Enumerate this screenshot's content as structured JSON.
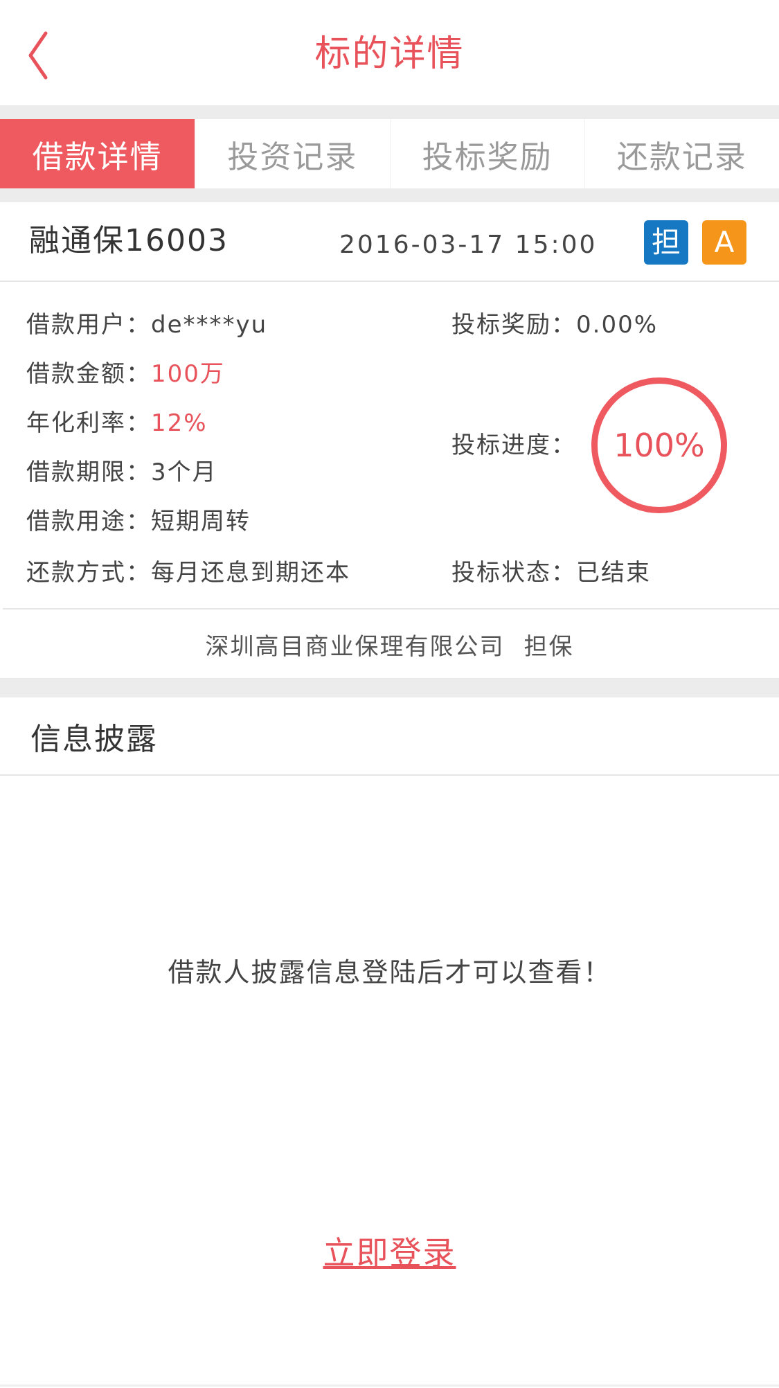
{
  "header": {
    "title": "标的详情",
    "back_icon": "chevron-left-icon"
  },
  "tabs": [
    {
      "label": "借款详情",
      "active": true
    },
    {
      "label": "投资记录",
      "active": false
    },
    {
      "label": "投标奖励",
      "active": false
    },
    {
      "label": "还款记录",
      "active": false
    }
  ],
  "loan": {
    "name": "融通保16003",
    "datetime": "2016-03-17 15:00",
    "badges": {
      "guarantee": "担",
      "grade": "A"
    }
  },
  "details": {
    "user_label": "借款用户：",
    "user_value": "de****yu",
    "amount_label": "借款金额：",
    "amount_value": "100万",
    "rate_label": "年化利率：",
    "rate_value": "12%",
    "term_label": "借款期限：",
    "term_value": "3个月",
    "purpose_label": "借款用途：",
    "purpose_value": "短期周转",
    "repay_label": "还款方式：",
    "repay_value": "每月还息到期还本",
    "reward_label": "投标奖励：",
    "reward_value": "0.00%",
    "progress_label": "投标进度：",
    "progress_value": "100%",
    "progress_fraction": 1.0,
    "status_label": "投标状态：",
    "status_value": "已结束"
  },
  "guarantor": {
    "company": "深圳高目商业保理有限公司",
    "type": "担保"
  },
  "info": {
    "title": "信息披露",
    "notice": "借款人披露信息登陆后才可以查看！",
    "login_link": "立即登录"
  },
  "colors": {
    "accent": "#e8525a",
    "tab_active_bg": "#ef5a60",
    "badge_guarantee": "#1678c2",
    "badge_grade": "#f5961a"
  }
}
